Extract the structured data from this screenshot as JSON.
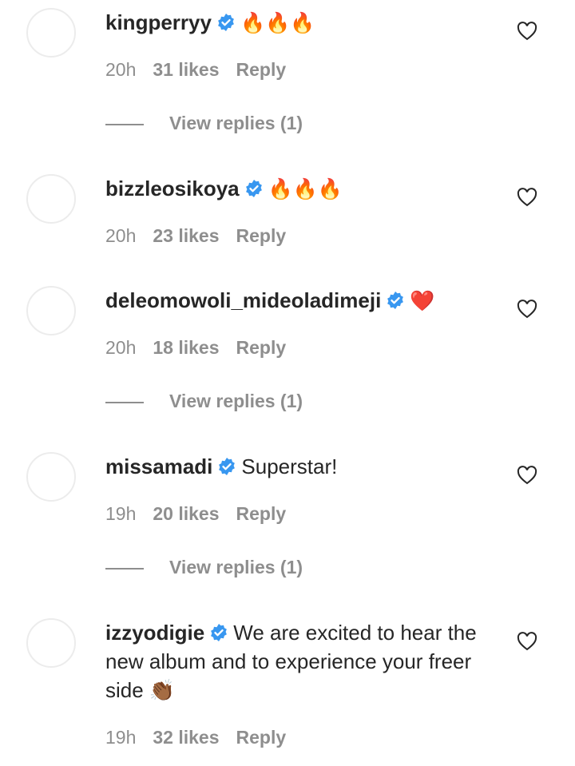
{
  "icons": {
    "verified": "verified-badge-icon",
    "heart": "heart-outline-icon"
  },
  "colors": {
    "verified": "#3897f0",
    "muted": "#8e8e8e",
    "text": "#262626"
  },
  "comments": [
    {
      "username": "kingperryy",
      "text": "🔥🔥🔥",
      "time": "20h",
      "likes": "31 likes",
      "reply": "Reply",
      "view_replies": "View replies (1)"
    },
    {
      "username": "bizzleosikoya",
      "text": "🔥🔥🔥",
      "time": "20h",
      "likes": "23 likes",
      "reply": "Reply"
    },
    {
      "username": "deleomowoli_mideoladimeji",
      "text": "❤️",
      "time": "20h",
      "likes": "18 likes",
      "reply": "Reply",
      "view_replies": "View replies (1)"
    },
    {
      "username": "missamadi",
      "text": "Superstar!",
      "time": "19h",
      "likes": "20 likes",
      "reply": "Reply",
      "view_replies": "View replies (1)"
    },
    {
      "username": "izzyodigie",
      "text": "We are excited to hear the new album and to experience your freer side 👏🏾",
      "time": "19h",
      "likes": "32 likes",
      "reply": "Reply"
    }
  ]
}
